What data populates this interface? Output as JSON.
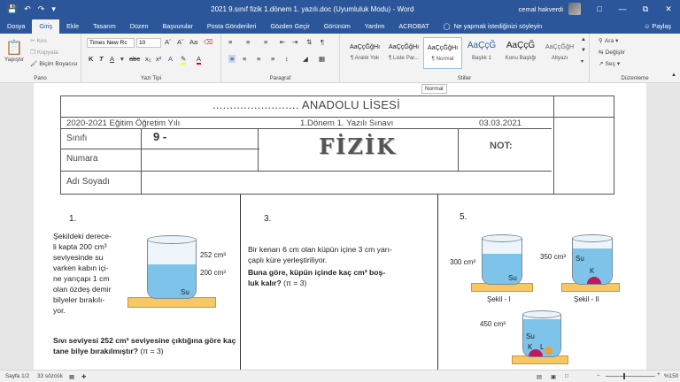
{
  "titlebar": {
    "title": "2021 9.sınıf fizik 1.dönem 1. yazılı.doc (Uyumluluk Modu) - Word",
    "user": "cemal hakverdi",
    "qat": {
      "save_icon": "save-icon",
      "undo_icon": "undo-icon",
      "redo_icon": "redo-icon"
    }
  },
  "tabs": [
    {
      "label": "Dosya"
    },
    {
      "label": "Giriş"
    },
    {
      "label": "Ekle"
    },
    {
      "label": "Tasarım"
    },
    {
      "label": "Düzen"
    },
    {
      "label": "Başvurular"
    },
    {
      "label": "Posta Gönderileri"
    },
    {
      "label": "Gözden Geçir"
    },
    {
      "label": "Görünüm"
    },
    {
      "label": "Yardım"
    },
    {
      "label": "ACROBAT"
    }
  ],
  "tell_me": "Ne yapmak istediğinizi söyleyin",
  "share": "Paylaş",
  "ribbon": {
    "clipboard": {
      "paste": "Yapıştır",
      "cut": "Kes",
      "copy": "Kopyala",
      "format_painter": "Biçim Boyacısı",
      "label": "Pano"
    },
    "font": {
      "name": "Times New Rc",
      "size": "10",
      "label": "Yazı Tipi"
    },
    "paragraph": {
      "label": "Paragraf"
    },
    "styles": {
      "label": "Stiller",
      "items": [
        {
          "sample": "AaÇçĞğHı",
          "name": "¶ Aralık Yok"
        },
        {
          "sample": "AaÇçĞğHı",
          "name": "¶ Liste Par..."
        },
        {
          "sample": "AaÇçĞğHı",
          "name": "¶ Normal"
        },
        {
          "sample": "AaÇçĞ",
          "name": "Başlık 1"
        },
        {
          "sample": "AaÇçĞ",
          "name": "Konu Başlığı"
        },
        {
          "sample": "AaÇçĞğH",
          "name": "Altyazı"
        }
      ]
    },
    "editing": {
      "find": "Ara",
      "replace": "Değiştir",
      "select": "Seç",
      "label": "Düzenleme"
    }
  },
  "tooltip": "Normal",
  "document": {
    "school": "......................... ANADOLU LİSESİ",
    "year": "2020-2021 Eğitim Öğretim Yılı",
    "exam": "1.Dönem 1. Yazılı Sınavı",
    "date": "03.03.2021",
    "class_label": "Sınıfı",
    "class_value": "9 -",
    "number_label": "Numara",
    "name_label": "Adı Soyadı",
    "subject": "FİZİK",
    "grade_label": "NOT:",
    "q1": {
      "num": "1.",
      "lines": [
        "Şekildeki derece-",
        "li kapta 200 cm³",
        "seviyesinde su",
        "varken kabın içi-",
        "ne yarıçapı 1 cm",
        "olan özdeş demir",
        "bilyeler bırakılı-",
        "yor."
      ],
      "question": "Sıvı seviyesi 252 cm³ seviyesine çıktığına göre kaç tane bilye bırakılmıştır?",
      "pi": "(π = 3)",
      "fig_top": "252 cm³",
      "fig_mid": "200 cm³",
      "fig_liquid": "Su"
    },
    "q3": {
      "num": "3.",
      "line1": "Bir kenarı 6 cm olan küpün içine 3 cm yarı-",
      "line2": "çaplı küre yerleştiriliyor.",
      "question": "Buna göre, küpün içinde kaç cm³ boş-",
      "question2": "luk kalır?",
      "pi": "(π = 3)"
    },
    "q5": {
      "num": "5.",
      "f1_vol": "300 cm³",
      "f1_liquid": "Su",
      "f1_caption": "Şekil - I",
      "f2_vol": "350 cm³",
      "f2_liquid": "Su",
      "f2_obj": "K",
      "f2_caption": "Şekil - II",
      "f3_vol": "450 cm³",
      "f3_liquid": "Su",
      "f3_obj_k": "K",
      "f3_obj_l": "L"
    }
  },
  "statusbar": {
    "page": "Sayfa 1/2",
    "words": "33 sözcük",
    "zoom": "%150"
  }
}
